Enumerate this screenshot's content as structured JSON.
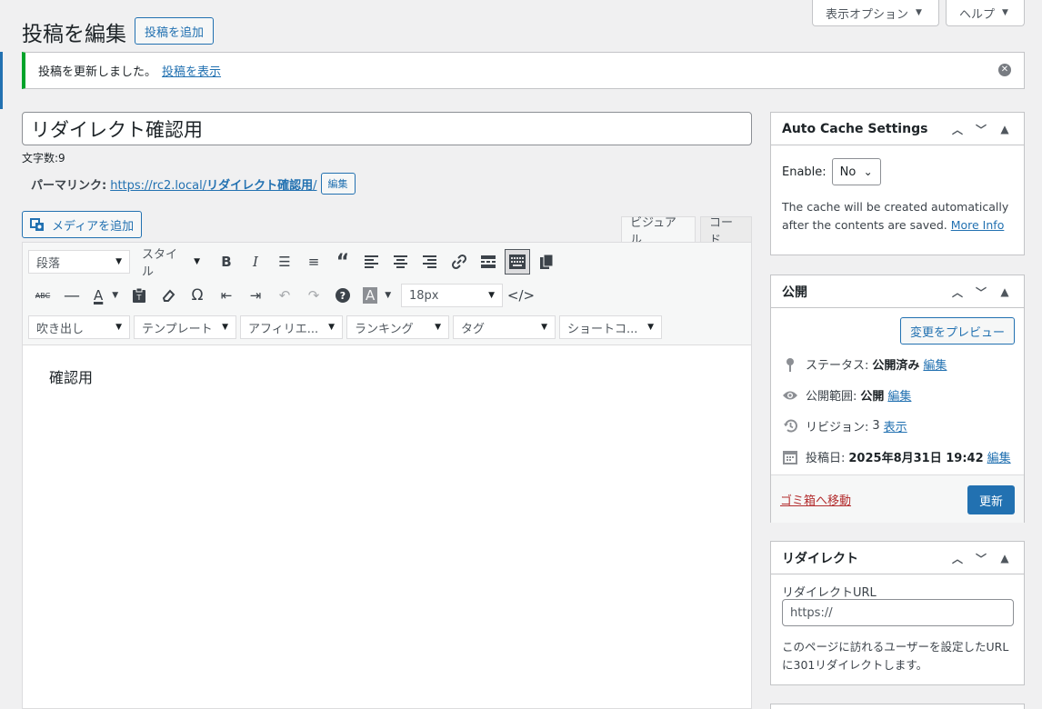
{
  "screen_options": {
    "label": "表示オプション"
  },
  "help": {
    "label": "ヘルプ"
  },
  "page_title": "投稿を編集",
  "add_new": "投稿を追加",
  "notice": {
    "text": "投稿を更新しました。",
    "link": "投稿を表示"
  },
  "post": {
    "title": "リダイレクト確認用",
    "word_count": "文字数:9"
  },
  "permalink": {
    "label": "パーマリンク:",
    "url_base": "https://rc2.local/",
    "url_slug": "リダイレクト確認用",
    "url_tail": "/",
    "edit": "編集"
  },
  "media_button": "メディアを追加",
  "tabs": {
    "visual": "ビジュアル",
    "code": "コード"
  },
  "toolbar": {
    "format": "段落",
    "style": "スタイル",
    "font_size": "18px",
    "selects": [
      "吹き出し",
      "テンプレート",
      "アフィリエ...",
      "ランキング",
      "タグ",
      "ショートコ..."
    ]
  },
  "content": {
    "text": "確認用"
  },
  "cache_box": {
    "title": "Auto Cache Settings",
    "enable_label": "Enable:",
    "enable_value": "No",
    "desc": "The cache will be created automatically after the contents are saved.",
    "more_info": "More Info"
  },
  "publish_box": {
    "title": "公開",
    "preview": "変更をプレビュー",
    "status_label": "ステータス:",
    "status_value": "公開済み",
    "status_edit": "編集",
    "visibility_label": "公開範囲:",
    "visibility_value": "公開",
    "visibility_edit": "編集",
    "revisions_label": "リビジョン:",
    "revisions_value": "3",
    "revisions_link": "表示",
    "date_label": "投稿日:",
    "date_value": "2025年8月31日 19:42",
    "date_edit": "編集",
    "trash": "ゴミ箱へ移動",
    "update": "更新"
  },
  "redirect_box": {
    "title": "リダイレクト",
    "url_label": "リダイレクトURL",
    "url_value": "https://",
    "desc": "このページに訪れるユーザーを設定したURLに301リダイレクトします。"
  }
}
